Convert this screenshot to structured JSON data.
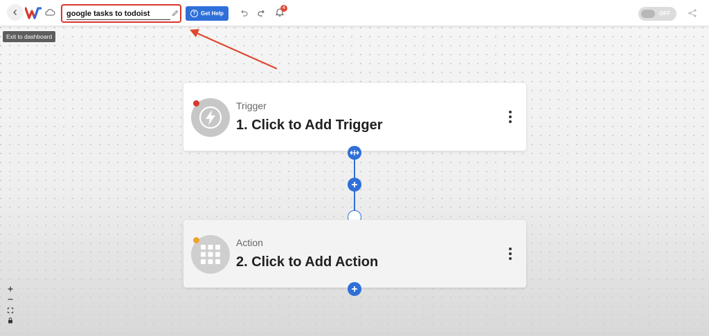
{
  "toolbar": {
    "workflow_name": "google tasks to todoist",
    "help_label": "Get Help",
    "notification_count": "4",
    "toggle_label": "OFF"
  },
  "tooltip": {
    "text": "Exit to dashboard"
  },
  "steps": [
    {
      "kind": "Trigger",
      "title": "1. Click to Add Trigger",
      "status_color": "#d53a2c",
      "icon": "lightning-bolt-icon"
    },
    {
      "kind": "Action",
      "title": "2. Click to Add Action",
      "status_color": "#f0a32a",
      "icon": "grid-apps-icon"
    }
  ],
  "colors": {
    "accent": "#2f6fd8",
    "highlight": "#d8372a",
    "badge": "#e24a3b"
  },
  "icons": {
    "back": "chevron-left-icon",
    "logo": "logo-icon",
    "cloud": "cloud-icon",
    "edit": "pencil-icon",
    "help": "question-circle-icon",
    "undo": "undo-icon",
    "redo": "redo-icon",
    "notifications": "bell-icon",
    "share": "share-icon",
    "more": "kebab-menu-icon"
  }
}
